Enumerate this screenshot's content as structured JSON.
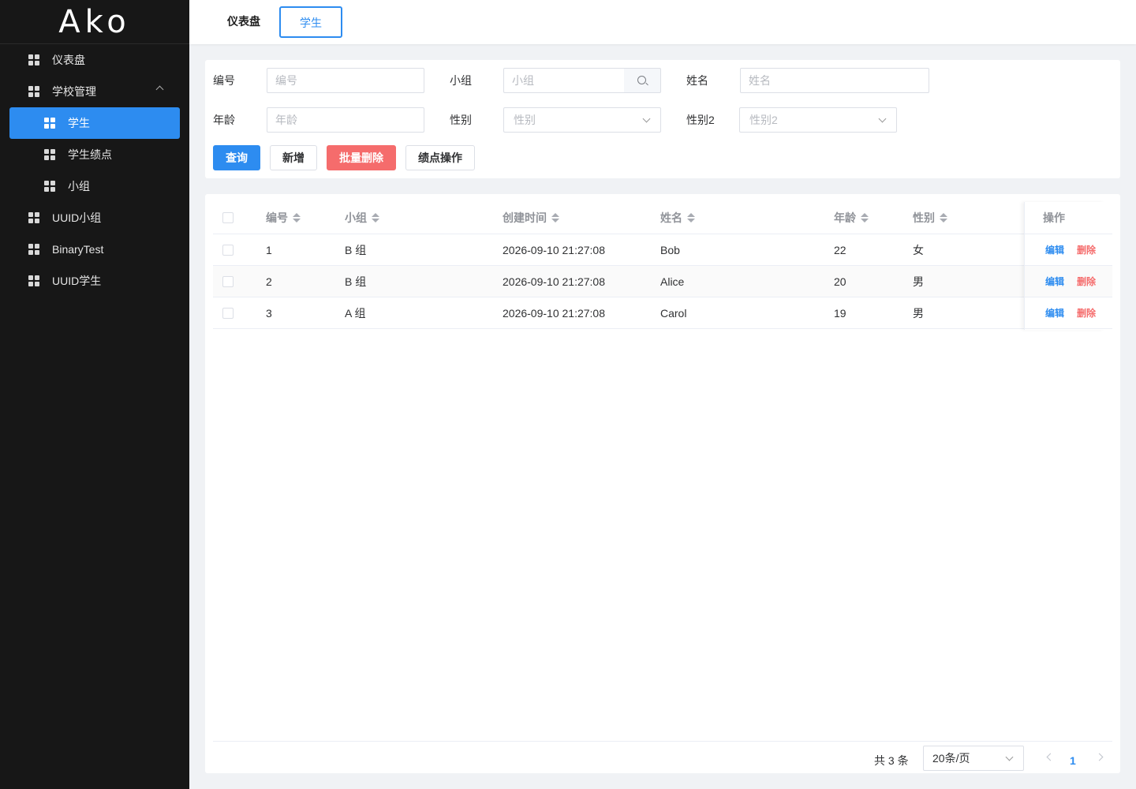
{
  "app": {
    "logo": "Ako"
  },
  "sidebar": {
    "items": [
      {
        "label": "仪表盘"
      },
      {
        "label": "学校管理"
      },
      {
        "label": "学生"
      },
      {
        "label": "学生绩点"
      },
      {
        "label": "小组"
      },
      {
        "label": "UUID小组"
      },
      {
        "label": "BinaryTest"
      },
      {
        "label": "UUID学生"
      }
    ]
  },
  "tabs": [
    {
      "label": "仪表盘"
    },
    {
      "label": "学生"
    }
  ],
  "filters": {
    "id": {
      "label": "编号",
      "placeholder": "编号"
    },
    "group": {
      "label": "小组",
      "placeholder": "小组"
    },
    "name": {
      "label": "姓名",
      "placeholder": "姓名"
    },
    "age": {
      "label": "年龄",
      "placeholder": "年龄"
    },
    "gender": {
      "label": "性别",
      "placeholder": "性别"
    },
    "gender2": {
      "label": "性别2",
      "placeholder": "性别2"
    }
  },
  "actions": {
    "query": "查询",
    "add": "新增",
    "batch_delete": "批量删除",
    "gpa_ops": "绩点操作"
  },
  "table": {
    "columns": [
      "编号",
      "小组",
      "创建时间",
      "姓名",
      "年龄",
      "性别",
      "操作"
    ],
    "rows": [
      {
        "id": "1",
        "group": "B 组",
        "created": "2026-09-10 21:27:08",
        "name": "Bob",
        "age": "22",
        "gender": "女"
      },
      {
        "id": "2",
        "group": "B 组",
        "created": "2026-09-10 21:27:08",
        "name": "Alice",
        "age": "20",
        "gender": "男"
      },
      {
        "id": "3",
        "group": "A 组",
        "created": "2026-09-10 21:27:08",
        "name": "Carol",
        "age": "19",
        "gender": "男"
      }
    ],
    "row_actions": {
      "edit": "编辑",
      "delete": "删除"
    }
  },
  "pagination": {
    "total_text": "共 3 条",
    "page_size": "20条/页",
    "current_page": "1"
  },
  "colors": {
    "accent": "#2d8cf0",
    "danger": "#f56c6c",
    "sidebar_bg": "#171717"
  }
}
